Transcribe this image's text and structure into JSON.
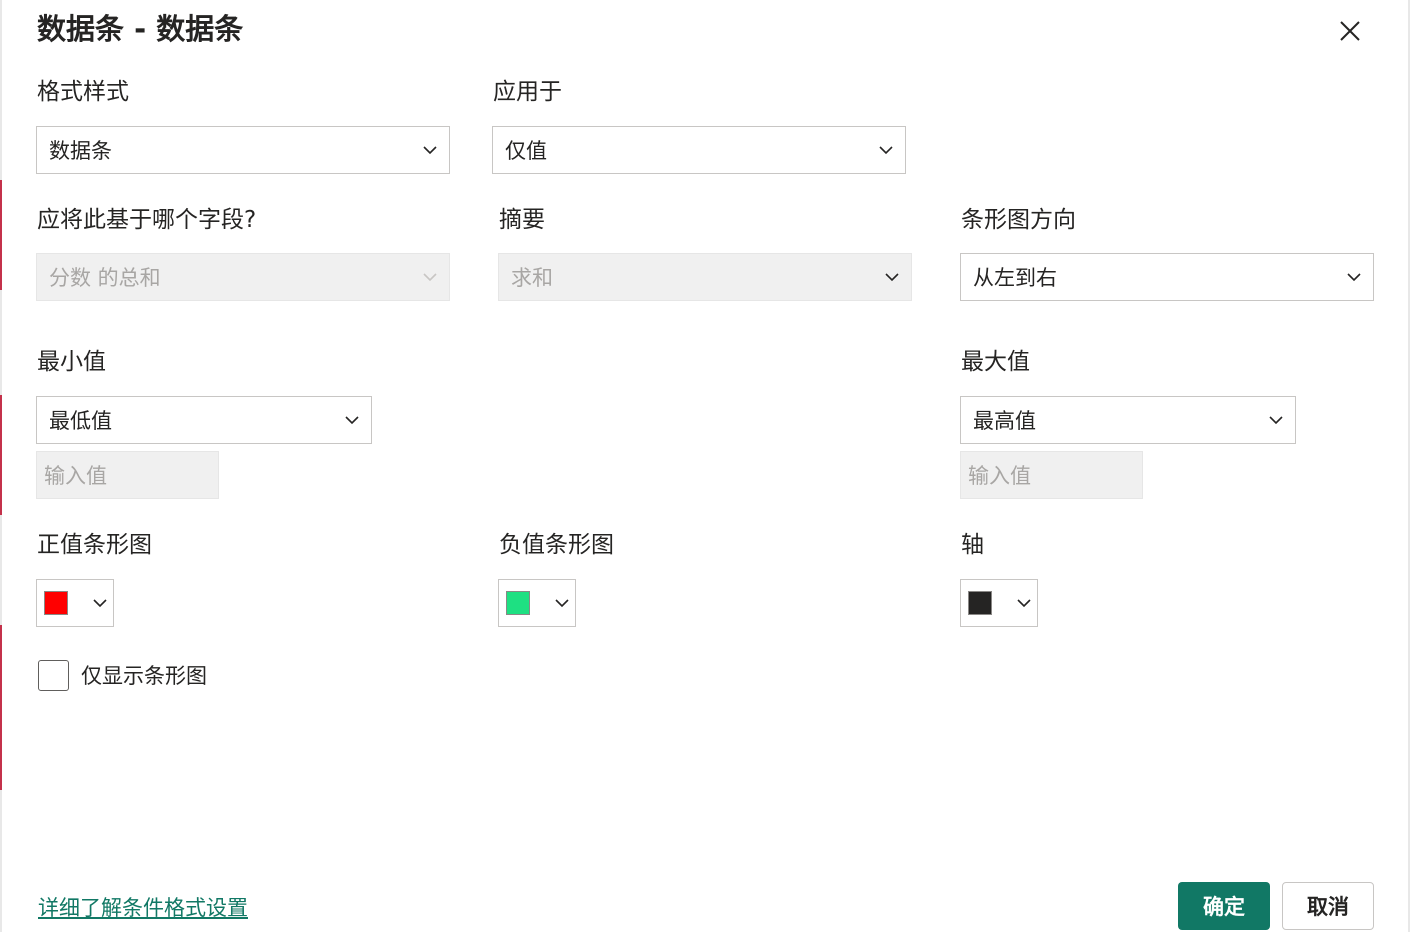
{
  "dialog": {
    "title": "数据条 - 数据条"
  },
  "format_style": {
    "label": "格式样式",
    "value": "数据条"
  },
  "apply_to": {
    "label": "应用于",
    "value": "仅值"
  },
  "base_field": {
    "label": "应将此基于哪个字段?",
    "value": "分数 的总和"
  },
  "summary": {
    "label": "摘要",
    "value": "求和"
  },
  "bar_direction": {
    "label": "条形图方向",
    "value": "从左到右"
  },
  "minimum": {
    "label": "最小值",
    "value": "最低值",
    "input_placeholder": "输入值"
  },
  "maximum": {
    "label": "最大值",
    "value": "最高值",
    "input_placeholder": "输入值"
  },
  "positive_bar": {
    "label": "正值条形图",
    "color": "#ff0000"
  },
  "negative_bar": {
    "label": "负值条形图",
    "color": "#1ee082"
  },
  "axis": {
    "label": "轴",
    "color": "#252423"
  },
  "show_bar_only": {
    "label": "仅显示条形图",
    "checked": false
  },
  "footer": {
    "learn_more_link": "详细了解条件格式设置",
    "ok_label": "确定",
    "cancel_label": "取消"
  },
  "colors": {
    "accent": "#117865",
    "disabled_bg": "#f0f0f0",
    "border": "#c8c6c4"
  }
}
